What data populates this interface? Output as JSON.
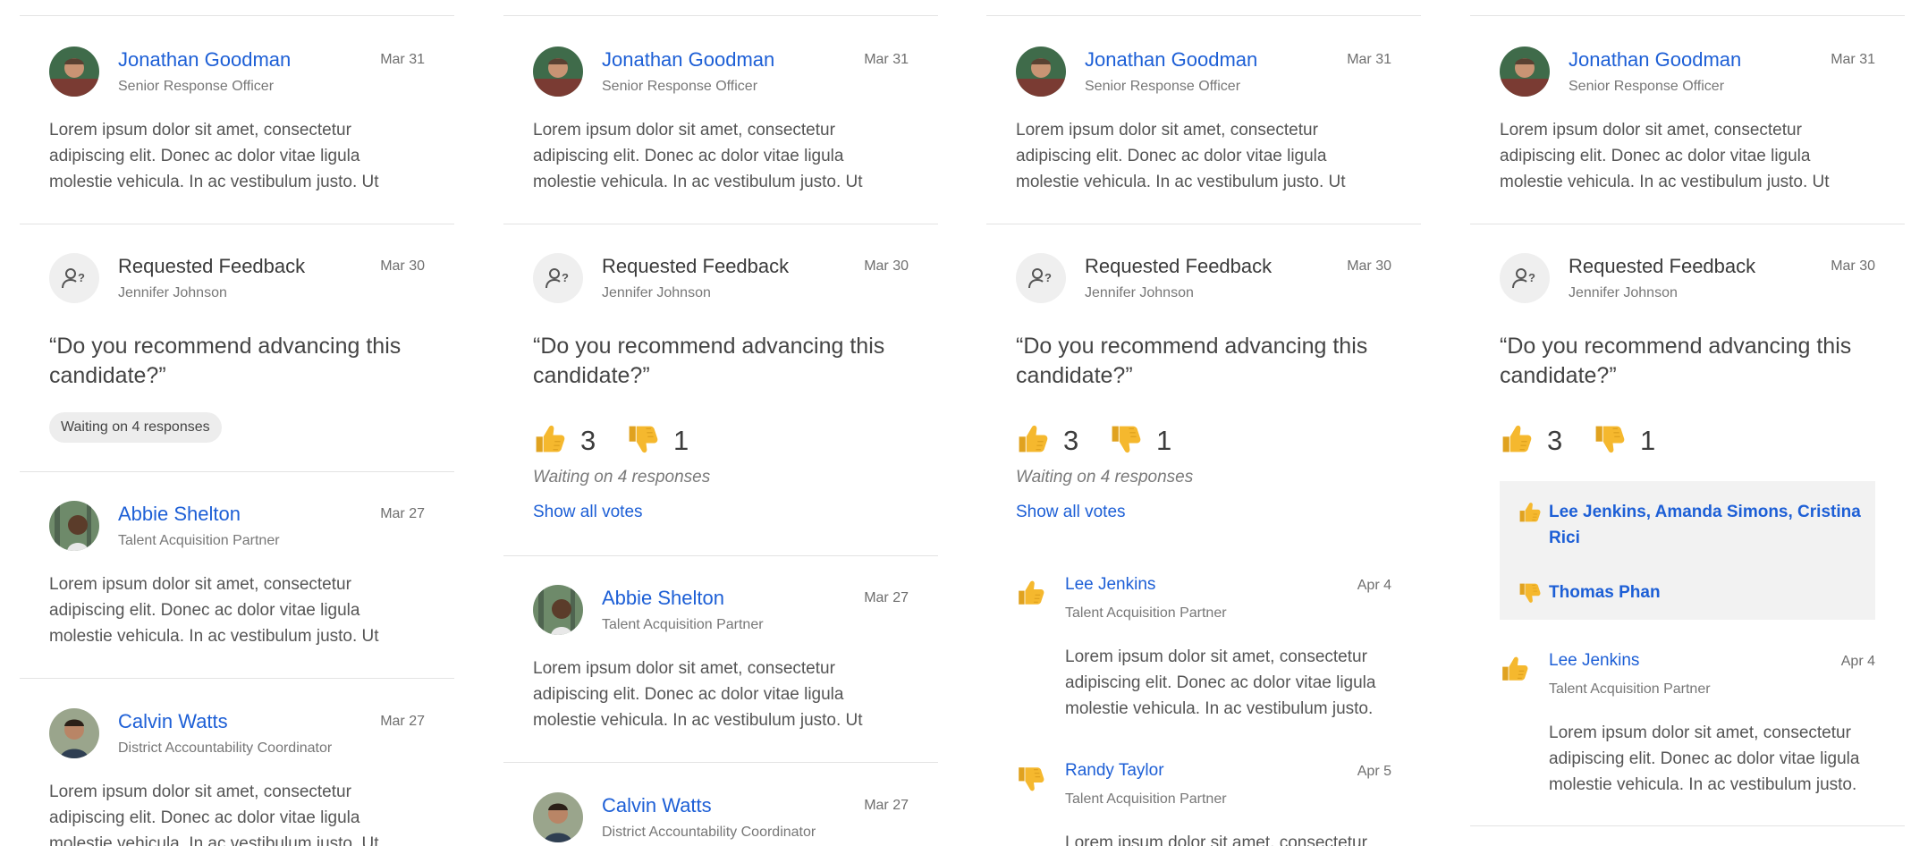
{
  "colors": {
    "link": "#1d5fd6",
    "divider": "#e3e3e3",
    "pill_bg": "#ededed",
    "thumb": "#f5b82e"
  },
  "post": {
    "name": "Jonathan Goodman",
    "role": "Senior Response Officer",
    "date": "Mar 31",
    "body": "Lorem ipsum dolor sit amet, consectetur adipiscing elit. Donec ac dolor vitae ligula molestie vehicula. In ac vestibulum justo. Ut"
  },
  "feedback": {
    "icon": "person-question-icon",
    "title": "Requested Feedback",
    "requester": "Jennifer Johnson",
    "date": "Mar 30",
    "question": "“Do you recommend advancing this candidate?”",
    "waiting_pill": "Waiting on 4 responses",
    "waiting_text": "Waiting on 4 responses",
    "up_count": "3",
    "down_count": "1",
    "show_all": "Show all votes"
  },
  "abbie": {
    "name": "Abbie Shelton",
    "role": "Talent Acquisition Partner",
    "date": "Mar 27",
    "body": "Lorem ipsum dolor sit amet, consectetur adipiscing elit. Donec ac dolor vitae ligula molestie vehicula. In ac vestibulum justo. Ut"
  },
  "calvin": {
    "name": "Calvin Watts",
    "role": "District Accountability Coordinator",
    "date": "Mar 27",
    "body": "Lorem ipsum dolor sit amet, consectetur adipiscing elit. Donec ac dolor vitae ligula molestie vehicula. In ac vestibulum justo. Ut"
  },
  "votes": {
    "lee": {
      "name": "Lee Jenkins",
      "role": "Talent Acquisition Partner",
      "date": "Apr 4",
      "body": "Lorem ipsum dolor sit amet, consectetur adipiscing elit. Donec ac dolor vitae ligula molestie vehicula. In ac vestibulum justo."
    },
    "randy": {
      "name": "Randy Taylor",
      "role": "Talent Acquisition Partner",
      "date": "Apr 5",
      "body_partial": "Lorem ipsum dolor sit amet, consectetur"
    }
  },
  "voters": {
    "up": "Lee Jenkins, Amanda Simons, Cristina Rici",
    "down": "Thomas Phan"
  }
}
